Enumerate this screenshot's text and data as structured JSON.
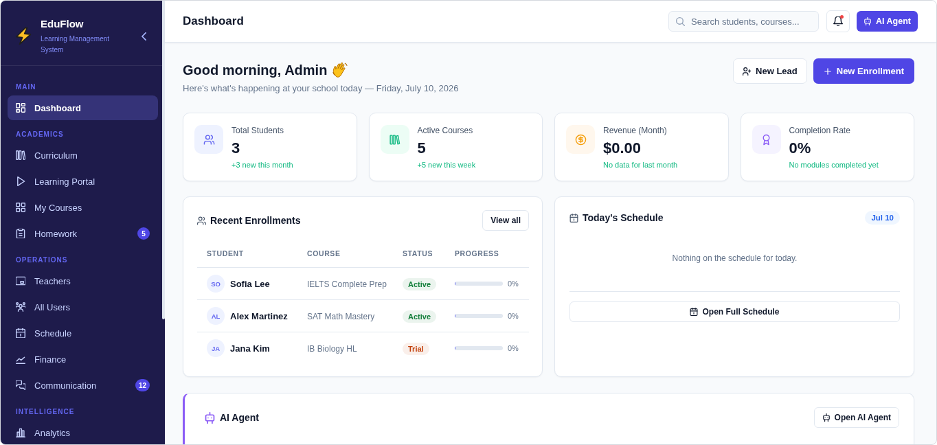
{
  "sidebar": {
    "brand": {
      "name": "EduFlow",
      "tagline": "Learning Management System"
    },
    "sections": [
      {
        "title": "MAIN",
        "items": [
          {
            "label": "Dashboard",
            "selected": true
          }
        ]
      },
      {
        "title": "ACADEMICS",
        "items": [
          {
            "label": "Curriculum",
            "selected": false
          },
          {
            "label": "Learning Portal",
            "selected": false
          },
          {
            "label": "My Courses",
            "selected": false
          },
          {
            "label": "Homework",
            "selected": false,
            "badge": "5"
          }
        ]
      },
      {
        "title": "OPERATIONS",
        "items": [
          {
            "label": "Teachers",
            "selected": false
          },
          {
            "label": "All Users",
            "selected": false
          },
          {
            "label": "Schedule",
            "selected": false
          },
          {
            "label": "Finance",
            "selected": false
          },
          {
            "label": "Communication",
            "selected": false,
            "badge": "12"
          }
        ]
      },
      {
        "title": "INTELLIGENCE",
        "items": [
          {
            "label": "Analytics",
            "selected": false
          }
        ]
      }
    ]
  },
  "header": {
    "title": "Dashboard",
    "search": {
      "placeholder": "Search students, courses..."
    },
    "notifications": {
      "unread": true
    },
    "agent_button": "AI Agent"
  },
  "greeting": {
    "title": "Good morning, Admin",
    "subtitle": "Here's what's happening at your school today — Friday, July 10, 2026",
    "actions": [
      {
        "label": "New Lead",
        "kind": "secondary"
      },
      {
        "label": "New Enrollment",
        "kind": "primary"
      }
    ]
  },
  "stats": [
    {
      "label": "Total Students",
      "value": "3",
      "note": "+3 new this month"
    },
    {
      "label": "Active Courses",
      "value": "5",
      "note": "+5 new this week"
    },
    {
      "label": "Revenue (Month)",
      "value": "$0.00",
      "note": "No data for last month"
    },
    {
      "label": "Completion Rate",
      "value": "0%",
      "note": "No modules completed yet"
    }
  ],
  "enrollments": {
    "title": "Recent Enrollments",
    "view_all": "View all",
    "columns": [
      "STUDENT",
      "COURSE",
      "STATUS",
      "PROGRESS"
    ],
    "rows": [
      {
        "initials": "SO",
        "student": "Sofia Lee",
        "course": "IELTS Complete Prep",
        "status": {
          "label": "Active",
          "color": "#15803d"
        },
        "level": 0,
        "progress": "0%"
      },
      {
        "initials": "AL",
        "student": "Alex Martinez",
        "course": "SAT Math Mastery",
        "status": {
          "label": "Active",
          "color": "#15803d"
        },
        "level": 0,
        "progress": "0%"
      },
      {
        "initials": "JA",
        "student": "Jana Kim",
        "course": "IB Biology HL",
        "status": {
          "label": "Trial",
          "color": "#c2410c"
        },
        "level": 0,
        "progress": "0%"
      }
    ]
  },
  "schedule": {
    "title": "Today's Schedule",
    "date": "Jul 10",
    "empty_message": "Nothing on the schedule for today.",
    "button": "Open Full Schedule"
  },
  "ai_agent": {
    "title": "AI Agent",
    "button": "Open AI Agent"
  }
}
